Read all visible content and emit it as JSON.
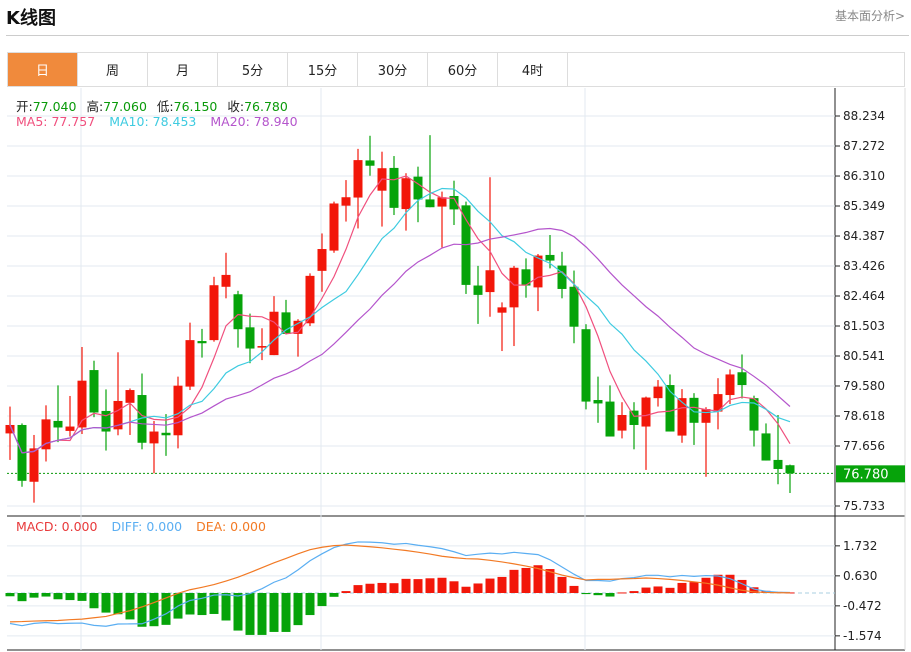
{
  "header": {
    "title": "K线图",
    "link": "基本面分析>"
  },
  "tabs": [
    {
      "label": "日",
      "active": true
    },
    {
      "label": "周"
    },
    {
      "label": "月"
    },
    {
      "label": "5分"
    },
    {
      "label": "15分"
    },
    {
      "label": "30分"
    },
    {
      "label": "60分"
    },
    {
      "label": "4时"
    }
  ],
  "info": {
    "open_label": "开:",
    "open": "77.040",
    "high_label": "高:",
    "high": "77.060",
    "low_label": "低:",
    "low": "76.150",
    "close_label": "收:",
    "close": "76.780"
  },
  "ma": {
    "ma5": "MA5: 77.757",
    "ma10": "MA10: 78.453",
    "ma20": "MA20: 78.940"
  },
  "macd_info": {
    "macd": "MACD: 0.000",
    "diff": "DIFF: 0.000",
    "dea": "DEA: 0.000"
  },
  "colors": {
    "up": "#f2170a",
    "down": "#06a30a",
    "ma5": "#f0507e",
    "ma10": "#3ecbe0",
    "ma20": "#b455cc",
    "diff": "#5aaef2",
    "dea": "#f27a25",
    "macd_label": "#e8393a"
  },
  "chart_data": [
    {
      "type": "candlestick",
      "title": "K线图",
      "yticks": [
        "88.234",
        "87.272",
        "86.310",
        "85.349",
        "84.387",
        "83.426",
        "82.464",
        "81.503",
        "80.541",
        "79.580",
        "78.618",
        "77.656",
        "75.733"
      ],
      "ylim": [
        75.733,
        88.234
      ],
      "last_price": "76.780",
      "ohlc": [
        [
          78.06,
          78.92,
          77.21,
          78.33
        ],
        [
          78.33,
          78.38,
          76.35,
          76.54
        ],
        [
          76.51,
          78.01,
          75.84,
          77.58
        ],
        [
          77.55,
          78.96,
          77.16,
          78.51
        ],
        [
          78.46,
          79.6,
          77.78,
          78.25
        ],
        [
          78.14,
          79.26,
          77.96,
          78.28
        ],
        [
          78.25,
          80.83,
          78.04,
          79.75
        ],
        [
          80.09,
          80.39,
          78.58,
          78.73
        ],
        [
          78.78,
          79.47,
          77.51,
          78.12
        ],
        [
          78.19,
          80.66,
          78.0,
          79.1
        ],
        [
          79.04,
          79.5,
          78.01,
          79.45
        ],
        [
          79.29,
          79.98,
          77.55,
          77.76
        ],
        [
          77.74,
          78.46,
          76.78,
          78.12
        ],
        [
          78.08,
          78.68,
          77.34,
          78.0
        ],
        [
          78.0,
          79.88,
          77.58,
          79.59
        ],
        [
          79.56,
          81.61,
          79.45,
          81.05
        ],
        [
          81.02,
          81.41,
          80.49,
          80.95
        ],
        [
          81.05,
          83.08,
          81.0,
          82.81
        ],
        [
          82.76,
          83.85,
          82.39,
          83.14
        ],
        [
          82.52,
          82.63,
          80.81,
          81.4
        ],
        [
          81.46,
          81.9,
          80.31,
          80.78
        ],
        [
          80.81,
          81.43,
          80.41,
          80.86
        ],
        [
          80.57,
          82.46,
          80.57,
          81.96
        ],
        [
          81.94,
          82.34,
          81.23,
          81.25
        ],
        [
          81.25,
          81.72,
          80.52,
          81.67
        ],
        [
          81.59,
          83.19,
          81.5,
          83.11
        ],
        [
          83.27,
          84.47,
          82.6,
          83.97
        ],
        [
          83.92,
          85.49,
          83.85,
          85.43
        ],
        [
          85.36,
          86.18,
          84.85,
          85.63
        ],
        [
          85.62,
          87.18,
          84.63,
          86.82
        ],
        [
          86.81,
          87.6,
          86.32,
          86.64
        ],
        [
          85.84,
          87.09,
          84.69,
          86.56
        ],
        [
          86.57,
          86.95,
          85.06,
          85.29
        ],
        [
          85.25,
          86.4,
          84.56,
          86.24
        ],
        [
          86.29,
          86.61,
          84.83,
          85.56
        ],
        [
          85.56,
          87.62,
          85.31,
          85.31
        ],
        [
          85.33,
          85.81,
          84.02,
          85.63
        ],
        [
          85.67,
          86.16,
          84.74,
          85.24
        ],
        [
          85.37,
          85.49,
          82.53,
          82.82
        ],
        [
          82.8,
          83.43,
          81.57,
          82.5
        ],
        [
          82.59,
          86.27,
          81.8,
          83.29
        ],
        [
          81.93,
          82.26,
          80.7,
          82.1
        ],
        [
          82.1,
          83.43,
          80.86,
          83.37
        ],
        [
          83.32,
          83.67,
          82.41,
          82.8
        ],
        [
          82.74,
          83.81,
          81.98,
          83.76
        ],
        [
          83.78,
          84.42,
          83.35,
          83.6
        ],
        [
          83.44,
          83.88,
          82.39,
          82.69
        ],
        [
          82.76,
          83.28,
          80.95,
          81.48
        ],
        [
          81.4,
          81.56,
          78.83,
          79.08
        ],
        [
          79.13,
          79.88,
          78.4,
          79.02
        ],
        [
          79.08,
          79.6,
          77.96,
          77.96
        ],
        [
          78.15,
          79.06,
          77.9,
          78.65
        ],
        [
          78.79,
          79.06,
          77.55,
          78.33
        ],
        [
          78.28,
          79.24,
          76.89,
          79.21
        ],
        [
          79.19,
          79.77,
          78.92,
          79.56
        ],
        [
          79.61,
          79.95,
          78.12,
          78.12
        ],
        [
          77.99,
          79.48,
          77.76,
          79.19
        ],
        [
          79.2,
          79.35,
          77.69,
          78.4
        ],
        [
          78.4,
          78.9,
          76.67,
          78.84
        ],
        [
          78.76,
          79.83,
          78.19,
          79.32
        ],
        [
          79.29,
          80.11,
          79.0,
          79.95
        ],
        [
          80.02,
          80.59,
          79.18,
          79.61
        ],
        [
          79.19,
          79.27,
          77.64,
          78.15
        ],
        [
          78.06,
          78.38,
          77.19,
          77.19
        ],
        [
          77.21,
          78.65,
          76.43,
          76.92
        ],
        [
          77.04,
          77.06,
          76.15,
          76.78
        ]
      ],
      "series": [
        {
          "name": "MA5"
        },
        {
          "name": "MA10"
        },
        {
          "name": "MA20"
        }
      ]
    },
    {
      "type": "bar",
      "title": "MACD",
      "yticks": [
        "1.732",
        "0.630",
        "-0.472",
        "-1.574"
      ],
      "ylim": [
        -1.8,
        2.2
      ],
      "macd": [
        -0.12,
        -0.3,
        -0.17,
        -0.13,
        -0.23,
        -0.26,
        -0.29,
        -0.56,
        -0.72,
        -0.78,
        -0.97,
        -1.24,
        -1.22,
        -1.17,
        -0.94,
        -0.79,
        -0.81,
        -0.77,
        -1.01,
        -1.38,
        -1.54,
        -1.54,
        -1.43,
        -1.43,
        -1.18,
        -0.81,
        -0.48,
        -0.14,
        0.07,
        0.29,
        0.34,
        0.37,
        0.36,
        0.52,
        0.51,
        0.54,
        0.56,
        0.43,
        0.23,
        0.35,
        0.53,
        0.59,
        0.85,
        0.92,
        1.02,
        0.88,
        0.59,
        0.26,
        -0.04,
        -0.08,
        -0.13,
        0.02,
        0.07,
        0.2,
        0.24,
        0.19,
        0.37,
        0.4,
        0.56,
        0.67,
        0.67,
        0.48,
        0.21,
        0.08,
        0.04,
        0.02
      ],
      "dea": [
        -1.06,
        -1.05,
        -1.03,
        -1.02,
        -1.01,
        -0.98,
        -0.96,
        -0.91,
        -0.86,
        -0.75,
        -0.65,
        -0.51,
        -0.35,
        -0.18,
        -0.01,
        0.12,
        0.21,
        0.31,
        0.44,
        0.58,
        0.75,
        0.93,
        1.11,
        1.27,
        1.44,
        1.59,
        1.68,
        1.74,
        1.76,
        1.73,
        1.7,
        1.66,
        1.61,
        1.56,
        1.5,
        1.43,
        1.35,
        1.3,
        1.26,
        1.25,
        1.2,
        1.14,
        1.07,
        0.99,
        0.9,
        0.78,
        0.66,
        0.56,
        0.48,
        0.5,
        0.5,
        0.52,
        0.53,
        0.55,
        0.53,
        0.5,
        0.46,
        0.41,
        0.36,
        0.29,
        0.19,
        0.1,
        0.04,
        0.02,
        0.01,
        0.01
      ]
    }
  ]
}
